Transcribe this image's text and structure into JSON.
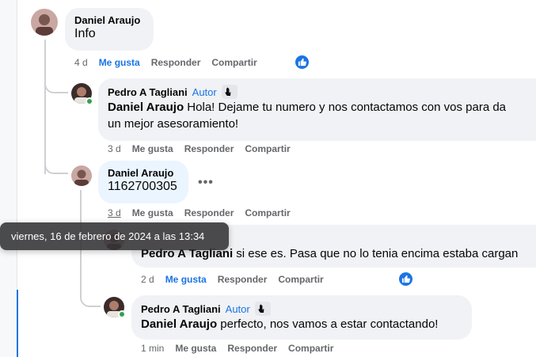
{
  "comments": [
    {
      "author": "Daniel Araujo",
      "text": "Info",
      "time": "4 d",
      "like_label": "Me gusta",
      "reply_label": "Responder",
      "share_label": "Compartir"
    },
    {
      "author": "Pedro A Tagliani",
      "badge": "Autor",
      "mention": "Daniel Araujo",
      "text_line1": " Hola! Dejame tu numero y nos contactamos con vos para da",
      "text_line2": "un mejor asesoramiento!",
      "time": "3 d",
      "like_label": "Me gusta",
      "reply_label": "Responder",
      "share_label": "Compartir"
    },
    {
      "author": "Daniel Araujo",
      "text": "1162700305",
      "time": "3 d",
      "more_label": "•••",
      "like_label": "Me gusta",
      "reply_label": "Responder",
      "share_label": "Compartir"
    },
    {
      "mention": "Pedro A Tagliani",
      "text": " si ese es. Pasa que no lo tenia encima estaba cargan",
      "time": "2 d",
      "like_label": "Me gusta",
      "reply_label": "Responder",
      "share_label": "Compartir"
    },
    {
      "author": "Pedro A Tagliani",
      "badge": "Autor",
      "mention": "Daniel Araujo",
      "text": " perfecto, nos vamos a estar contactando!",
      "time": "1 min",
      "like_label": "Me gusta",
      "reply_label": "Responder",
      "share_label": "Compartir"
    }
  ],
  "tooltip": "viernes, 16 de febrero de 2024 a las 13:34",
  "colors": {
    "accent": "#1b74e4",
    "bubble": "#f0f2f5",
    "bubble_highlight": "#ebf5ff",
    "meta": "#65676b",
    "online": "#31a24c"
  },
  "icons": {
    "like": "thumbs-up-icon",
    "wave": "wave-hand-icon",
    "more": "more-dots-icon"
  }
}
